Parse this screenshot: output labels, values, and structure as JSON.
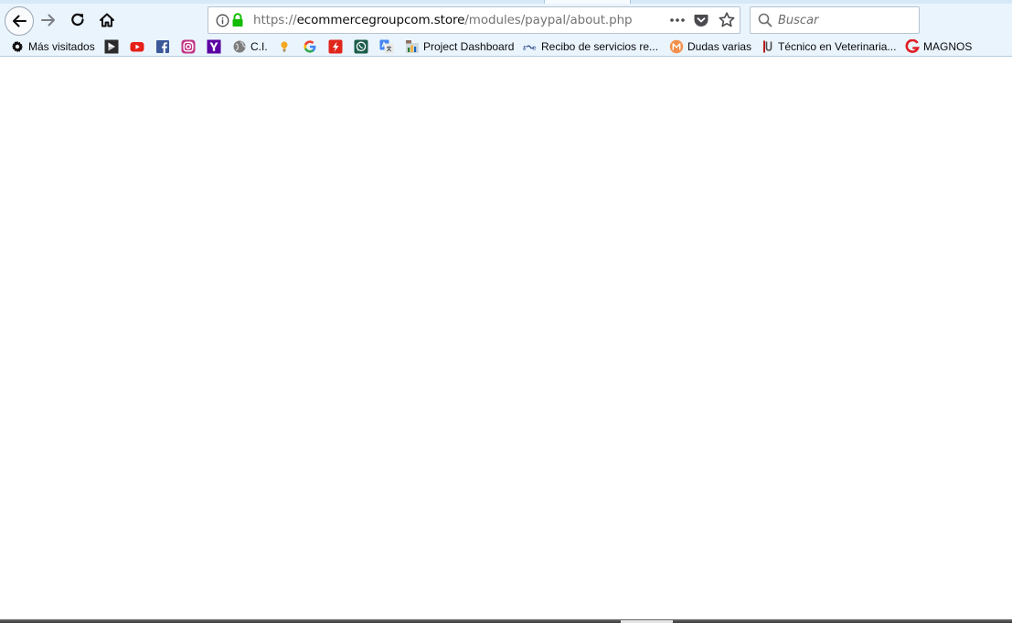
{
  "browser": {
    "url": {
      "scheme": "https://",
      "host": "ecommercegroupcom.store",
      "path": "/modules/paypal/about.php"
    },
    "search": {
      "placeholder": "Buscar"
    },
    "accent": "#eaf4fd",
    "secure_lock_color": "#12bc00"
  },
  "bookmarks": [
    {
      "label": "Más visitados",
      "icon": "gear-icon"
    },
    {
      "label": "",
      "icon": "play-icon"
    },
    {
      "label": "",
      "icon": "youtube-icon"
    },
    {
      "label": "",
      "icon": "facebook-icon"
    },
    {
      "label": "",
      "icon": "instagram-icon"
    },
    {
      "label": "",
      "icon": "yahoo-icon"
    },
    {
      "label": "C.I.",
      "icon": "globe-icon"
    },
    {
      "label": "",
      "icon": "bulb-icon"
    },
    {
      "label": "",
      "icon": "google-icon"
    },
    {
      "label": "",
      "icon": "flash-icon"
    },
    {
      "label": "",
      "icon": "whatsapp-icon"
    },
    {
      "label": "",
      "icon": "translate-icon"
    },
    {
      "label": "Project Dashboard",
      "icon": "dashboard-icon"
    },
    {
      "label": "Recibo de servicios re...",
      "icon": "receipt-icon"
    },
    {
      "label": "Dudas varias",
      "icon": "m-circle-icon"
    },
    {
      "label": "Técnico en Veterinaria...",
      "icon": "u-logo-icon"
    },
    {
      "label": "MAGNOS",
      "icon": "g-logo-icon"
    }
  ]
}
